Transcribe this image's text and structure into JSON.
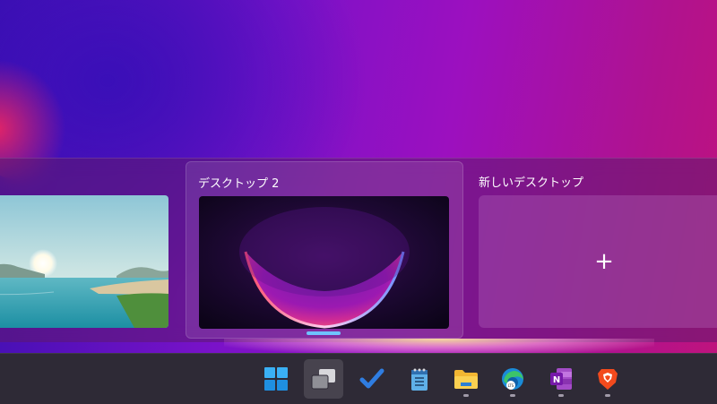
{
  "task_view": {
    "desktops": [
      {
        "title": "",
        "wallpaper": "lake-landscape"
      },
      {
        "title": "デスクトップ 2",
        "wallpaper": "windows-bloom"
      },
      {
        "title": "新しいデスクトップ",
        "action_symbol": "+"
      }
    ]
  },
  "taskbar": {
    "items": [
      {
        "icon": "windows-start-icon",
        "running": false
      },
      {
        "icon": "task-view-icon",
        "running": false,
        "active": true
      },
      {
        "icon": "todo-check-icon",
        "running": false
      },
      {
        "icon": "notepad-icon",
        "running": false
      },
      {
        "icon": "file-explorer-icon",
        "running": true
      },
      {
        "icon": "edge-browser-icon",
        "running": true
      },
      {
        "icon": "onenote-icon",
        "running": true
      },
      {
        "icon": "brave-browser-icon",
        "running": true
      }
    ]
  },
  "colors": {
    "accent": "#6fc3ff",
    "taskbar": "#2e2a36"
  }
}
